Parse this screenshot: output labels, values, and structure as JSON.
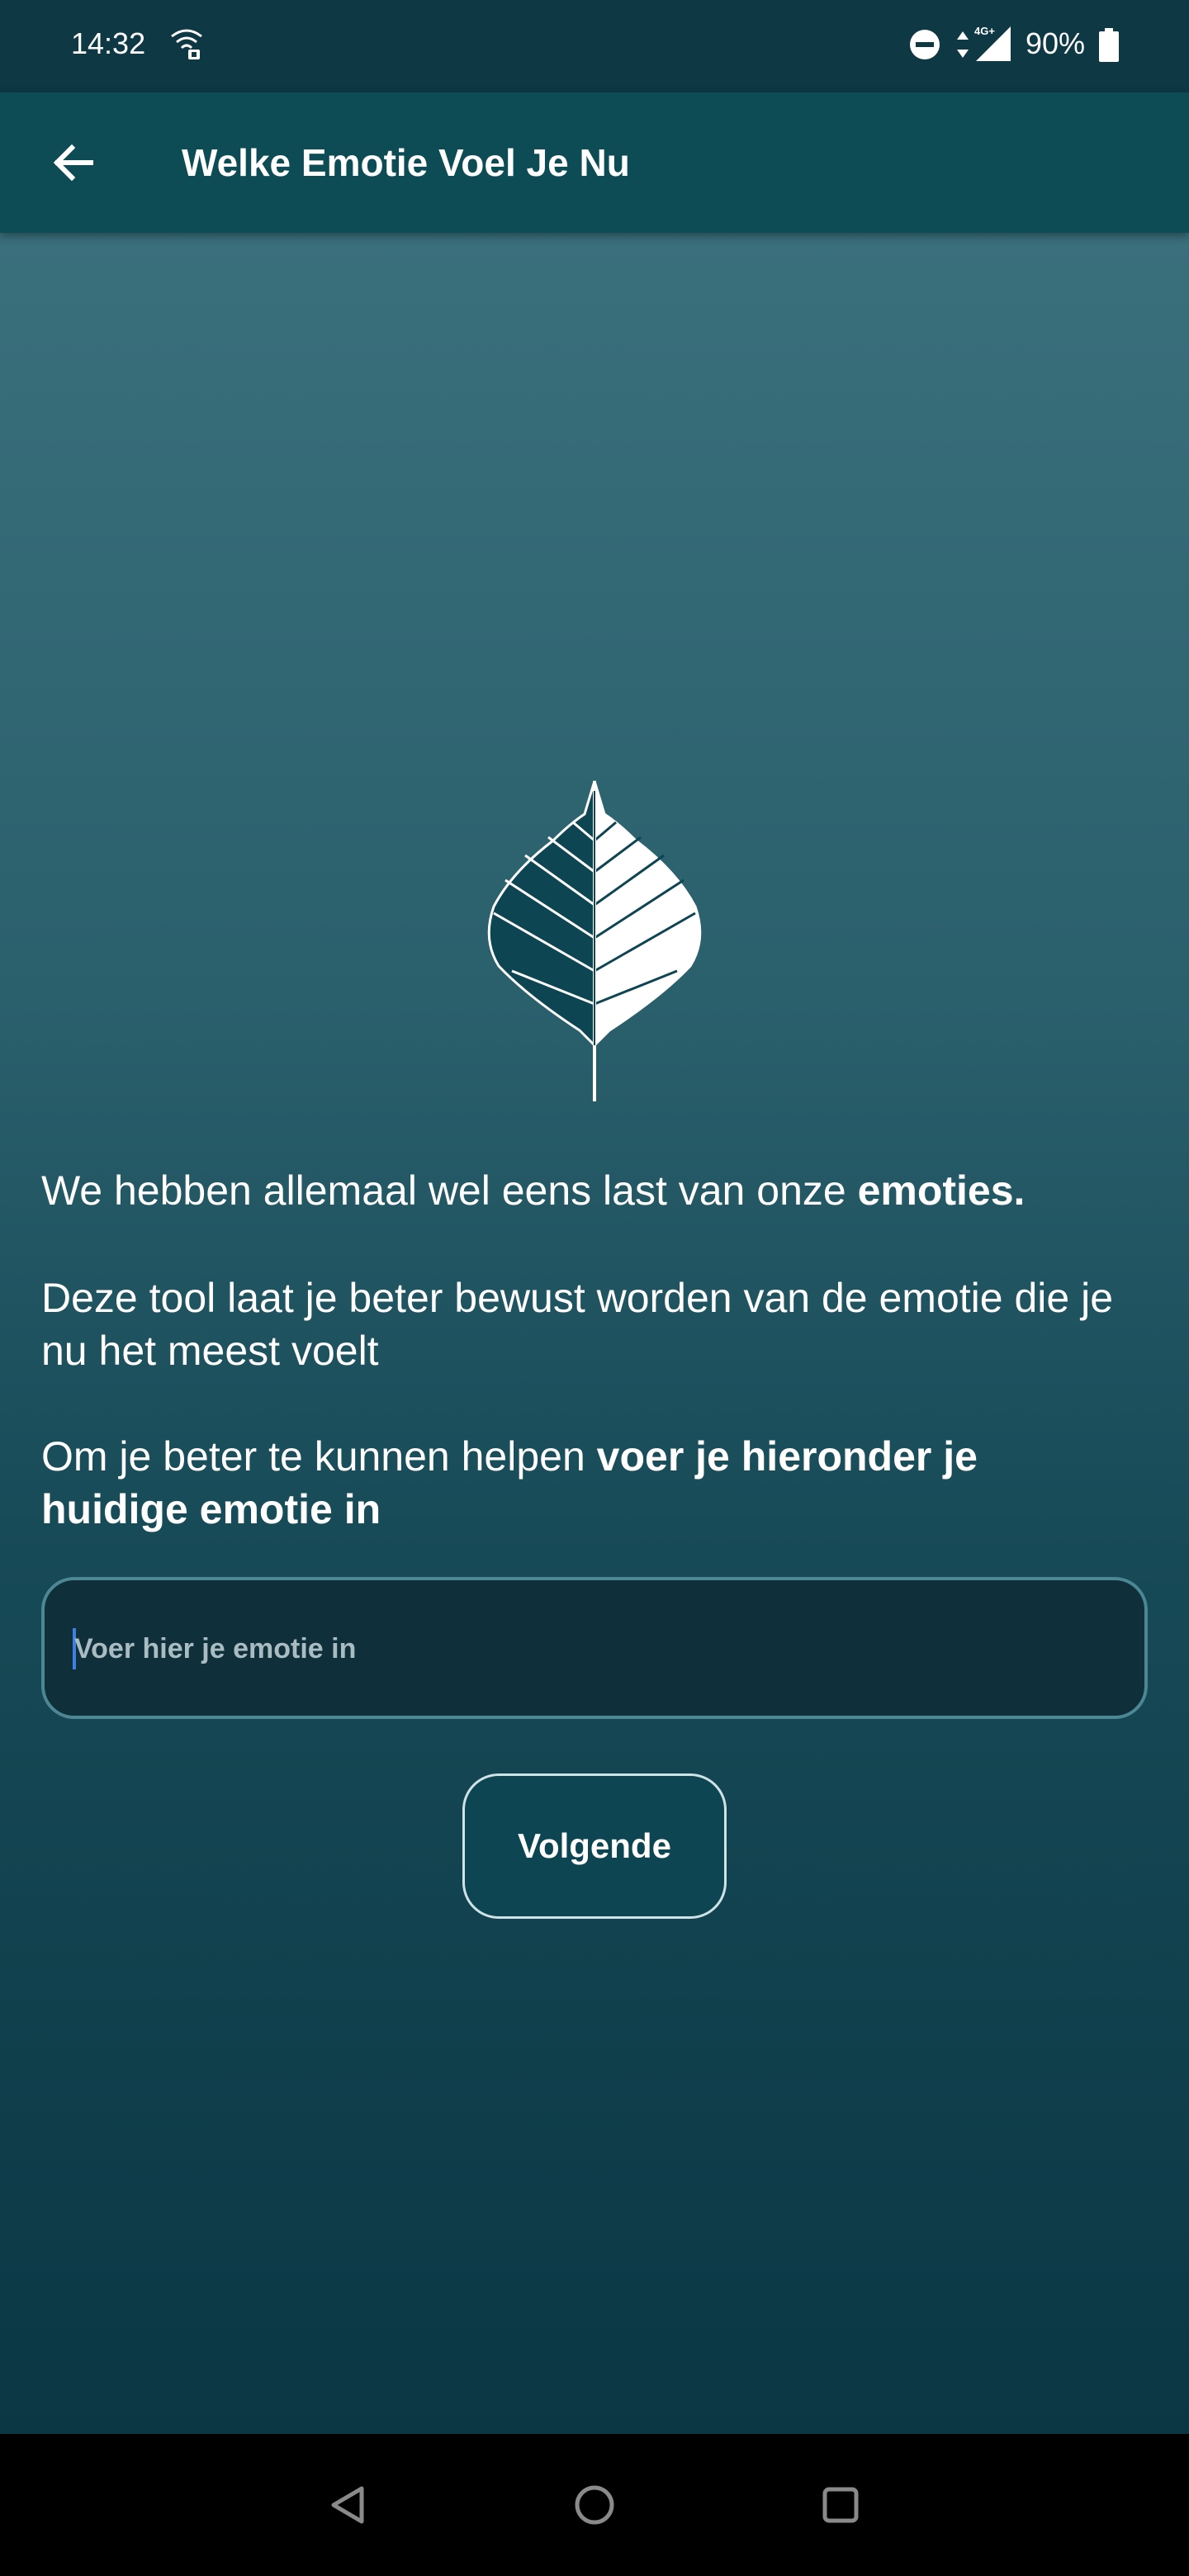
{
  "status_bar": {
    "time": "14:32",
    "battery_percent": "90%",
    "network": "4G+",
    "icons": [
      "wifi-calling-icon",
      "do-not-disturb-icon",
      "data-arrows-icon",
      "signal-icon",
      "battery-icon"
    ]
  },
  "app_bar": {
    "title": "Welke Emotie Voel Je Nu",
    "back_icon": "arrow-left-icon"
  },
  "content": {
    "logo_icon": "leaf-icon",
    "intro": {
      "text": "We hebben allemaal wel eens last van onze ",
      "bold": "emoties."
    },
    "description": "Deze tool laat je beter bewust worden van de emotie die je nu het meest voelt",
    "instruction": {
      "text": "Om je beter te kunnen helpen ",
      "bold": "voer je hieronder je huidige emotie in"
    },
    "emotion_input": {
      "placeholder": "Voer hier je emotie in",
      "value": ""
    },
    "next_button_label": "Volgende"
  },
  "nav_bar": {
    "icons": [
      "back-triangle-icon",
      "home-circle-icon",
      "recents-square-icon"
    ]
  },
  "colors": {
    "app_bar": "#0d4b55",
    "status_bar": "#0d3844",
    "background_top": "#3a6f7c",
    "background_bottom": "#0b3744",
    "input_border": "#4c8793",
    "button_bg": "#0d4552",
    "caret": "#3f7fe0"
  }
}
